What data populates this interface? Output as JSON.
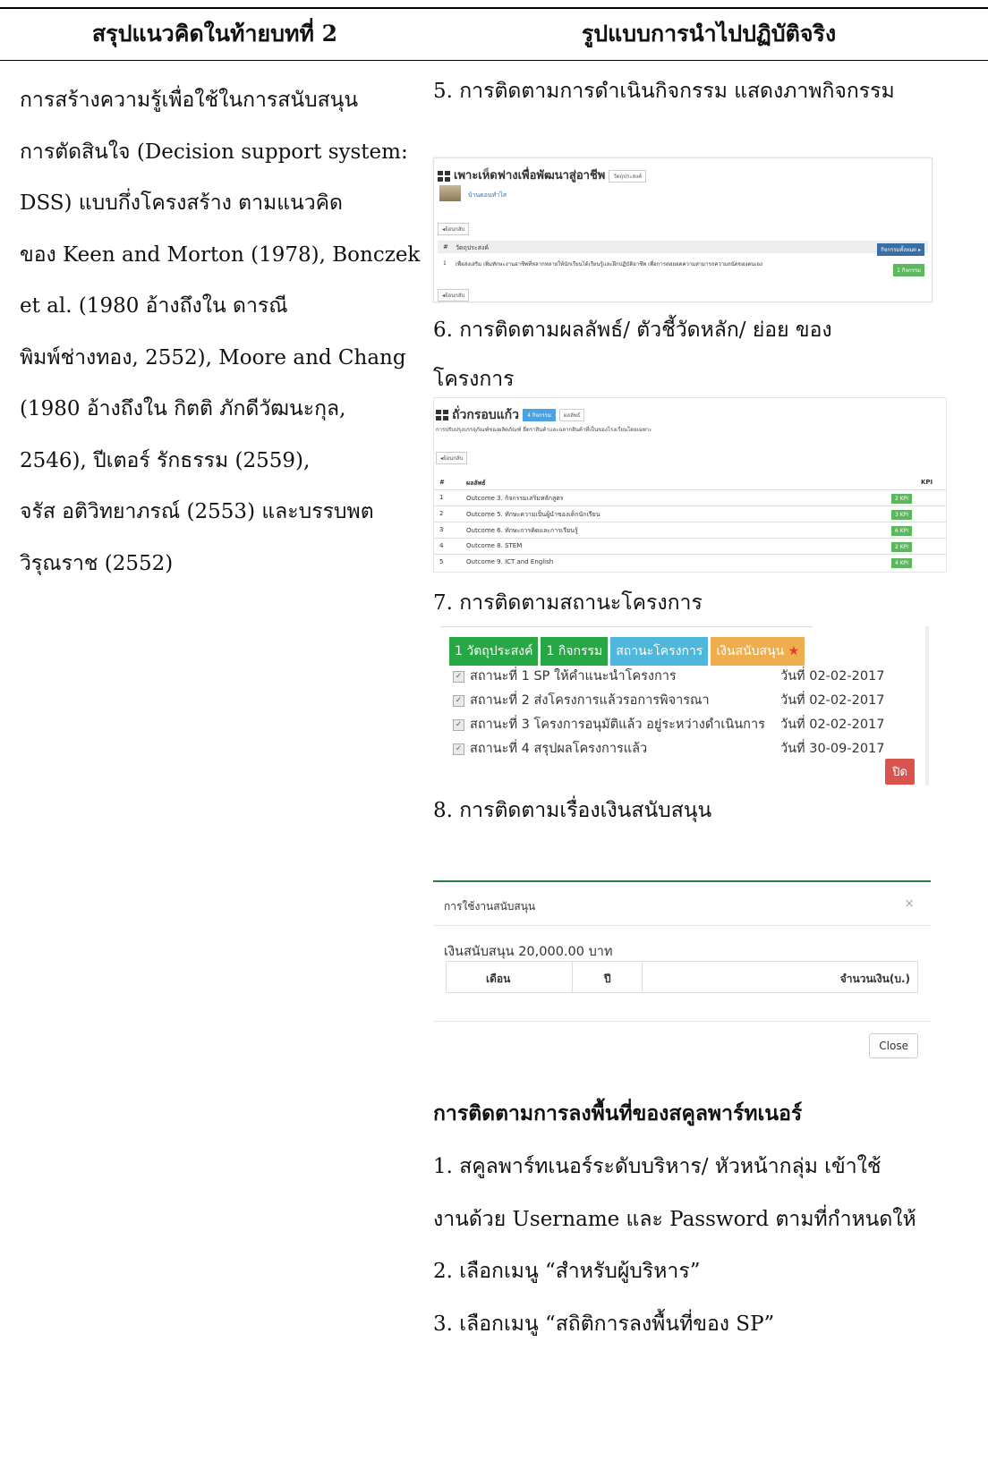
{
  "header": {
    "left": "สรุปแนวคิดในท้ายบทที่ 2",
    "right": "รูปแบบการนำไปปฏิบัติจริง"
  },
  "left_lines": [
    "การสร้างความรู้เพื่อใช้ในการสนับสนุน",
    "การตัดสินใจ (Decision support system:",
    "DSS) แบบกึ่งโครงสร้าง ตามแนวคิด",
    "ของ Keen and Morton (1978), Bonczek",
    "et al. (1980 อ้างถึงใน ดารณี",
    "พิมพ์ช่างทอง, 2552), Moore and Chang",
    "(1980 อ้างถึงใน กิตติ ภักดีวัฒนะกุล,",
    "2546), ปีเตอร์ รักธรรม (2559),",
    "จรัส อติวิทยาภรณ์ (2553) และบรรบพต",
    "วิรุณราช (2552)"
  ],
  "items": {
    "i5": "5. การติดตามการดำเนินกิจกรรม แสดงภาพกิจกรรม",
    "i6a": "6. การติดตามผลลัพธ์/ ตัวชี้วัดหลัก/ ย่อย ของ",
    "i6b": "โครงการ",
    "i7": "7. การติดตามสถานะโครงการ",
    "i8": "8. การติดตามเรื่องเงินสนับสนุน",
    "sp_title": "การติดตามการลงพื้นที่ของสคูลพาร์ทเนอร์",
    "sp1a": "1. สคูลพาร์ทเนอร์ระดับบริหาร/ หัวหน้ากลุ่ม เข้าใช้",
    "sp1b": "งานด้วย Username และ Password ตามที่กำหนดให้",
    "sp2": "2. เลือกเมนู “สำหรับผู้บริหาร”",
    "sp3": "3. เลือกเมนู “สถิติการลงพื้นที่ของ SP”"
  },
  "panel_activity": {
    "title": "เพาะเห็ดฟางเพื่อพัฒนาสู่อาชีพ",
    "tag": "วัตถุประสงค์",
    "thumb_label": "บ้านดอนทำไส",
    "back": "◂ย้อนกลับ",
    "col_num": "#",
    "col_objective": "วัตถุประสงค์",
    "btn_activity": "กิจกรรมทั้งหมด ▸",
    "row_num": "1",
    "row_text": "เพื่อส่งเสริม เพิ่มทักษะงานอาชีพที่หลากหลายให้นักเรียนได้เรียนรู้และฝึกปฏิบัติอาชีพ เพื่อการต่อยอดความสามารถความถนัดของตนเอง",
    "row_btn": "1 กิจกรรม",
    "back2": "◂ย้อนกลับ"
  },
  "panel_outcome": {
    "title": "ถั่วกรอบแก้ว",
    "tag1": "4 กิจกรรม",
    "tag2": "ผลลัพธ์",
    "desc": "การปรับปรุงบรรจุภัณฑ์ของผลิตภัณฑ์ ยืดราสินค้าและฉลากสินค้าที่เป็นของโรงเรียนโดยเฉพาะ",
    "back": "◂ย้อนกลับ",
    "col_num": "#",
    "col_outcome": "ผลลัพธ์",
    "col_kpi": "KPI",
    "rows": [
      {
        "n": "1",
        "name": "Outcome 3. กิจกรรมเสริมหลักสูตร",
        "kpi": "2 KPI"
      },
      {
        "n": "2",
        "name": "Outcome 5. ทักษะความเป็นผู้นำของเด็กนักเรียน",
        "kpi": "3 KPI"
      },
      {
        "n": "3",
        "name": "Outcome 6. ทักษะการคิดและการเรียนรู้",
        "kpi": "6 KPI"
      },
      {
        "n": "4",
        "name": "Outcome 8. STEM",
        "kpi": "2 KPI"
      },
      {
        "n": "5",
        "name": "Outcome 9. ICT and English",
        "kpi": "4 KPI"
      }
    ]
  },
  "panel_status": {
    "tabs": [
      "1 วัตถุประสงค์",
      "1 กิจกรรม",
      "สถานะโครงการ",
      "เงินสนับสนุน"
    ],
    "star": "★",
    "rows": [
      {
        "label": "สถานะที่ 1 SP ให้คำแนะนำโครงการ",
        "date": "วันที่ 02-02-2017"
      },
      {
        "label": "สถานะที่ 2 ส่งโครงการแล้วรอการพิจารณา",
        "date": "วันที่ 02-02-2017"
      },
      {
        "label": "สถานะที่ 3 โครงการอนุมัติแล้ว อยู่ระหว่างดำเนินการ",
        "date": "วันที่ 02-02-2017"
      },
      {
        "label": "สถานะที่ 4 สรุปผลโครงการแล้ว",
        "date": "วันที่ 30-09-2017"
      }
    ],
    "close": "ปิด"
  },
  "panel_funding": {
    "title": "การใช้งานสนับสนุน",
    "close_x": "×",
    "amount": "เงินสนับสนุน 20,000.00 บาท",
    "col_month": "เดือน",
    "col_year": "ปี",
    "col_amount": "จำนวนเงิน(บ.)",
    "close": "Close"
  },
  "colors": {
    "green": "#28a745",
    "blue": "#4fb6dc",
    "orange": "#f0ad4e",
    "red": "#d9534f"
  }
}
